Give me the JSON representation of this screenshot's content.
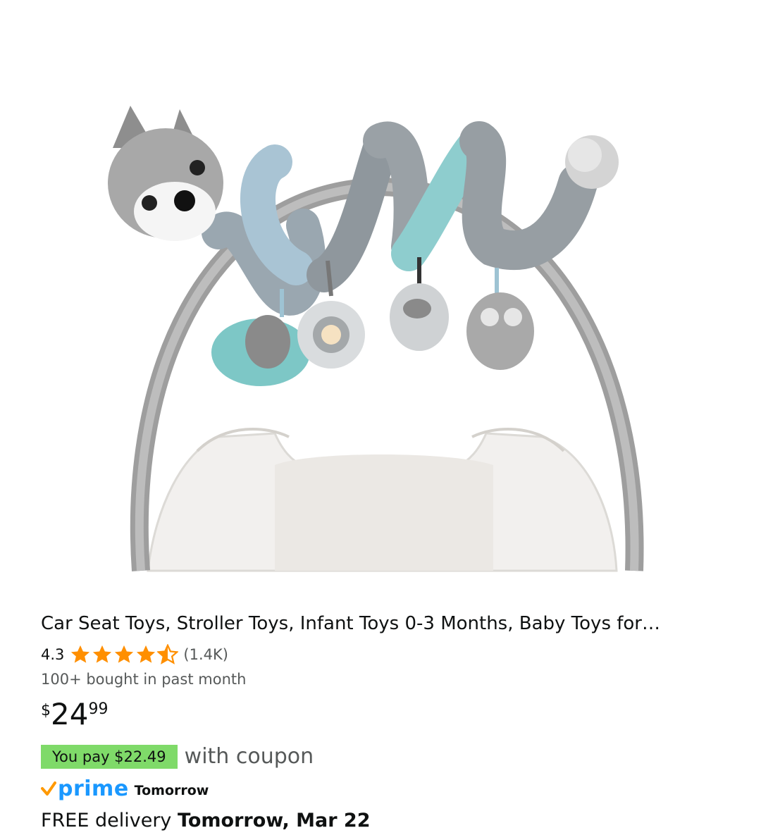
{
  "product": {
    "title": "Car Seat Toys, Stroller Toys, Infant Toys 0-3 Months, Baby Toys for…",
    "rating": "4.3",
    "stars": {
      "value": 4.3,
      "max": 5,
      "icon": "star-icon",
      "color": "#ff8f00"
    },
    "review_count": "(1.4K)",
    "bought": "100+ bought in past month",
    "price": {
      "symbol": "$",
      "whole": "24",
      "fraction": "99"
    },
    "coupon": {
      "badge": "You pay $22.49",
      "text": "with coupon",
      "badge_color": "#7fda69"
    },
    "prime": {
      "label": "prime",
      "speed": "Tomorrow",
      "color": "#1a98ff",
      "check_color": "#ff9900"
    },
    "delivery": {
      "prefix": "FREE delivery",
      "date": "Tomorrow, Mar 22"
    }
  }
}
